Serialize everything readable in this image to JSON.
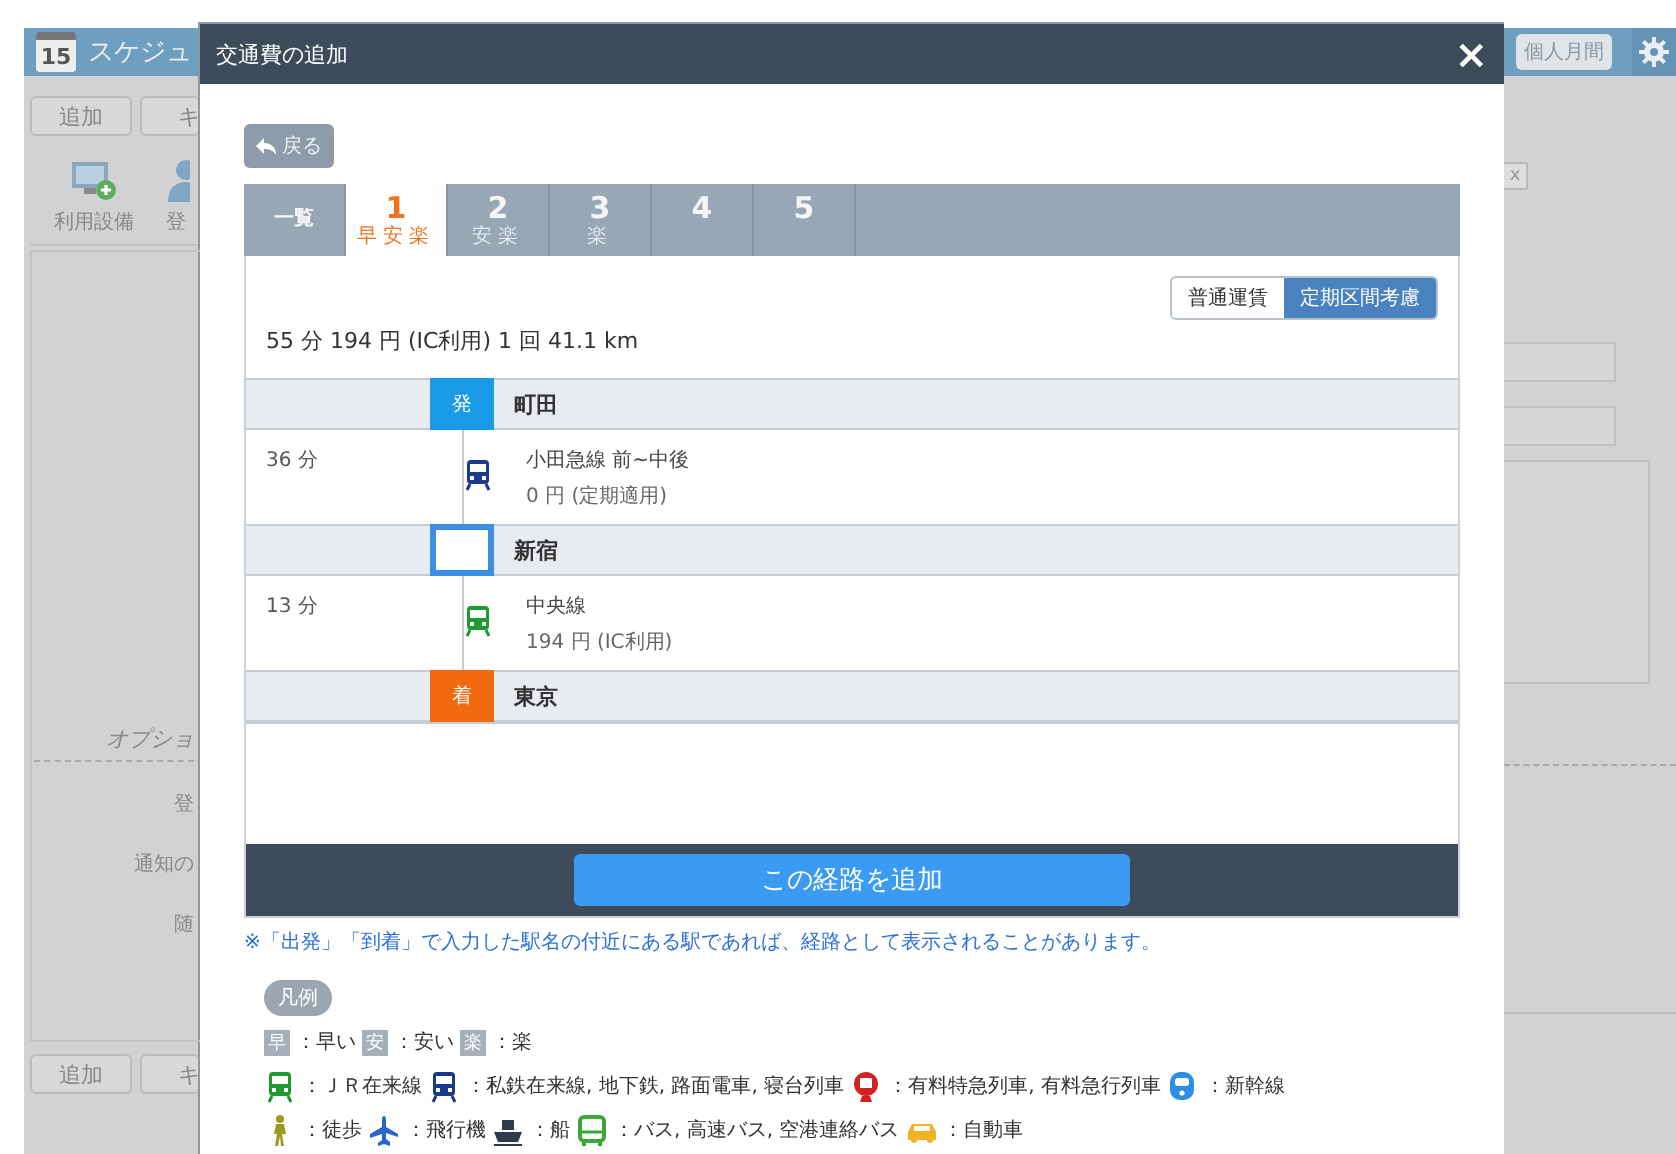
{
  "app": {
    "calendar_day": "15",
    "title": "スケジュ",
    "view_button": "個人月間",
    "top_buttons": [
      "追加",
      "キ"
    ],
    "toolbar": [
      {
        "label": "利用設備",
        "kind": "equipment"
      },
      {
        "label": "登",
        "kind": "person"
      }
    ],
    "form_labels": [
      "オプショ",
      "登",
      "通知の",
      "随"
    ],
    "small_button": "x",
    "bottom_buttons": [
      "追加",
      "キ"
    ]
  },
  "dialog": {
    "title": "交通費の追加",
    "close": "×",
    "back": "戻る",
    "tabs": [
      {
        "label": "一覧",
        "selected": false
      },
      {
        "label": "1",
        "sub": "早安楽",
        "selected": true
      },
      {
        "label": "2",
        "sub": "安楽",
        "selected": false
      },
      {
        "label": "3",
        "sub": "楽",
        "selected": false
      },
      {
        "label": "4",
        "selected": false
      },
      {
        "label": "5",
        "selected": false
      }
    ],
    "fare_modes": [
      {
        "label": "普通運賃",
        "selected": false
      },
      {
        "label": "定期区間考慮",
        "selected": true
      }
    ],
    "summary": "55 分 194 円 (IC利用) 1 回 41.1 km",
    "route": [
      {
        "kind": "departure",
        "badge": "発",
        "name": "町田"
      },
      {
        "kind": "segment",
        "icon": {
          "kind": "private"
        },
        "time": "36 分",
        "line": "小田急線 前~中後",
        "fare": "0 円 (定期適用)"
      },
      {
        "kind": "transfer",
        "name": "新宿"
      },
      {
        "kind": "segment",
        "icon": {
          "kind": "jr"
        },
        "time": "13 分",
        "line": "中央線",
        "fare": "194 円 (IC利用)"
      },
      {
        "kind": "arrival",
        "badge": "着",
        "name": "東京"
      }
    ],
    "add_button": "この経路を追加",
    "note": "※「出発」「到着」で入力した駅名の付近にある駅であれば、経路として表示されることがあります。",
    "legend": {
      "title": "凡例",
      "ranks": [
        {
          "mark": "早",
          "text": "：早い"
        },
        {
          "mark": "安",
          "text": "：安い"
        },
        {
          "mark": "楽",
          "text": "：楽"
        }
      ],
      "items": [
        {
          "kind": "jr",
          "text": "：ＪＲ在来線"
        },
        {
          "kind": "private",
          "text": "：私鉄在来線, 地下鉄, 路面電車, 寝台列車"
        },
        {
          "kind": "express",
          "text": "：有料特急列車, 有料急行列車"
        },
        {
          "kind": "shinkansen",
          "text": "：新幹線"
        },
        {
          "kind": "walk",
          "text": "：徒歩"
        },
        {
          "kind": "plane",
          "text": "：飛行機"
        },
        {
          "kind": "ship",
          "text": "：船"
        },
        {
          "kind": "bus",
          "text": "：バス, 高速バス, 空港連絡バス"
        },
        {
          "kind": "car",
          "text": "：自動車"
        }
      ]
    }
  }
}
